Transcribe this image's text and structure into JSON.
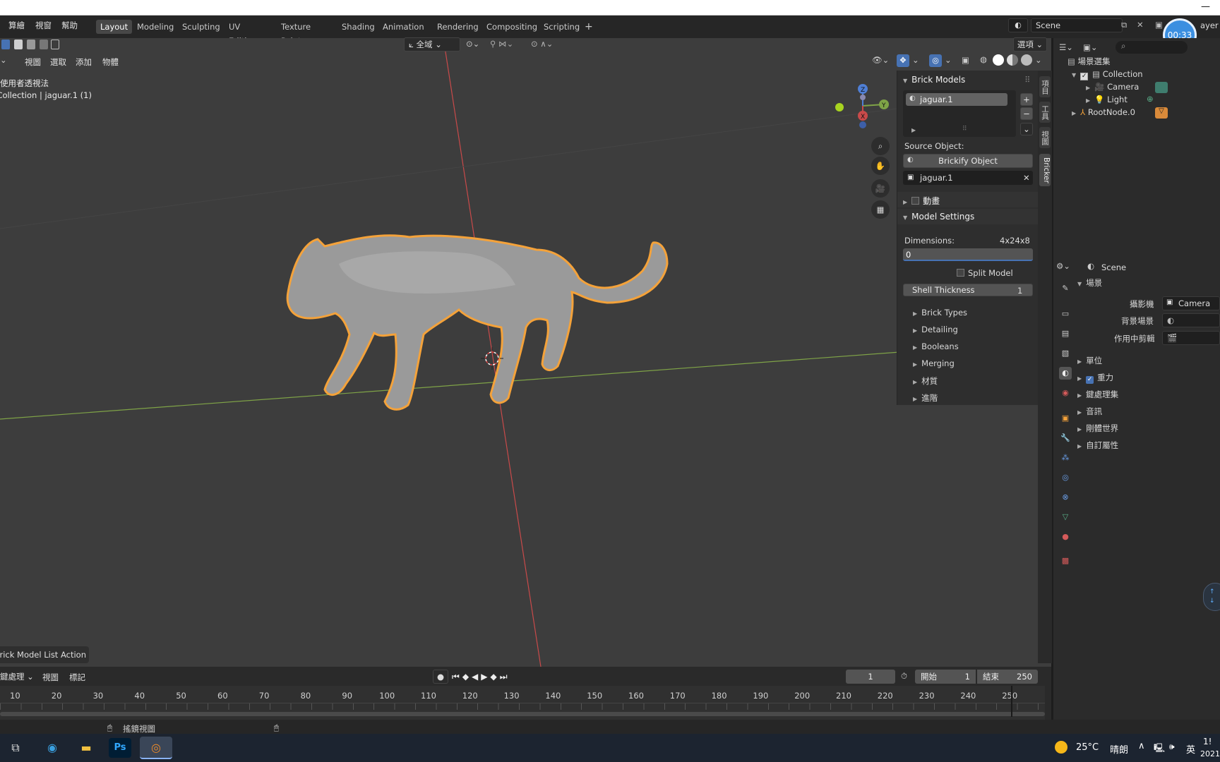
{
  "menu": {
    "file": "算繪",
    "window": "視窗",
    "help": "幫助"
  },
  "workspaces": [
    "Layout",
    "Modeling",
    "Sculpting",
    "UV Editing",
    "Texture Paint",
    "Shading",
    "Animation",
    "Rendering",
    "Compositing",
    "Scripting"
  ],
  "scene_field": "Scene",
  "view_layer_label": "ayer",
  "timer": "00:33",
  "viewport_header": {
    "orientation": "全域",
    "options": "選項"
  },
  "viewport_menu": {
    "view": "視圖",
    "select": "選取",
    "add": "添加",
    "object": "物體"
  },
  "viewport_overlay": {
    "mode": "使用者透視法",
    "context": "(1) Collection | jaguar.1"
  },
  "last_operator": "Brick Model List Action",
  "bricker": {
    "panel_title": "Brick Models",
    "list_item": "jaguar.1",
    "source_label": "Source Object:",
    "brickify_button": "Brickify Object",
    "source_object": "jaguar.1",
    "animation_label": "動畫",
    "model_settings": "Model Settings",
    "dimensions_label": "Dimensions:",
    "dimensions_value": "4x24x8",
    "dimensions_input": "0",
    "split_model": "Split Model",
    "shell_thickness_label": "Shell Thickness",
    "shell_thickness_value": "1",
    "subpanels": [
      "Brick Types",
      "Detailing",
      "Booleans",
      "Merging",
      "材質",
      "進階"
    ]
  },
  "side_tabs": [
    "項目",
    "工具",
    "視圖",
    "Bricker"
  ],
  "outliner": {
    "root": "場景選集",
    "collection": "Collection",
    "camera": "Camera",
    "light": "Light",
    "rootnode": "RootNode.0"
  },
  "properties": {
    "scene_name": "Scene",
    "section_scene": "場景",
    "camera_label": "攝影機",
    "camera_value": "Camera",
    "bg_scene_label": "背景場景",
    "clip_label": "作用中剪輯",
    "units": "單位",
    "gravity": "重力",
    "keying_sets": "鍵處理集",
    "audio": "音訊",
    "rigid_world": "剛體世界",
    "custom_props": "自訂屬性"
  },
  "timeline": {
    "keying": "鍵處理",
    "view": "視圖",
    "marker": "標記",
    "current_frame": "1",
    "start_label": "開始",
    "start_value": "1",
    "end_label": "結束",
    "end_value": "250",
    "ticks": [
      "10",
      "20",
      "30",
      "40",
      "50",
      "60",
      "70",
      "80",
      "90",
      "100",
      "110",
      "120",
      "130",
      "140",
      "150",
      "160",
      "170",
      "180",
      "190",
      "200",
      "210",
      "220",
      "230",
      "240",
      "250"
    ]
  },
  "statusbar": {
    "action": "搖鏡視圖"
  },
  "taskbar": {
    "weather_temp": "25°C",
    "weather_desc": "晴朗",
    "ime": "英",
    "clock_time": "1!",
    "clock_date": "2021"
  },
  "colors": {
    "accent_orange": "#f4a23a",
    "selected_blue": "#4772b3",
    "x_axis": "#c94a4a",
    "y_axis": "#7fa347"
  }
}
